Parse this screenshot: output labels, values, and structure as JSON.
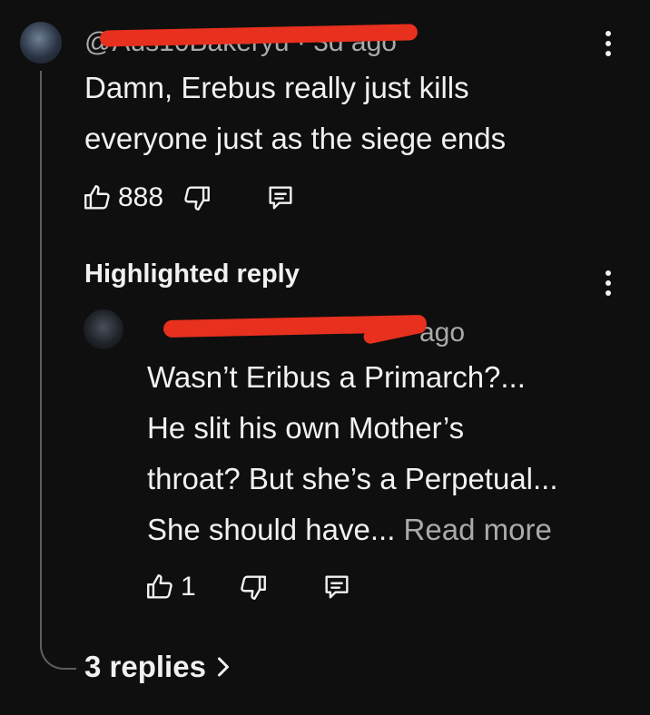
{
  "main_comment": {
    "handle": "@Aus10Bakeryu · 3d ago",
    "text_lines": [
      "Damn, Erebus really just kills",
      "everyone just as the siege ends"
    ],
    "like_count": "888"
  },
  "highlighted_label": "Highlighted reply",
  "reply": {
    "handle_suffix": "ago",
    "text_lines": [
      "Wasn’t Eribus a Primarch?...",
      "He slit his own Mother’s",
      "throat? But she’s a Perpetual...",
      "She should have..."
    ],
    "read_more": "Read more",
    "like_count": "1"
  },
  "replies_link": "3 replies",
  "icons": {
    "like": "thumbs-up-icon",
    "dislike": "thumbs-down-icon",
    "reply": "comment-icon",
    "more": "more-vert-icon",
    "chevron": "chevron-right-icon"
  },
  "colors": {
    "background": "#0f0f0f",
    "text": "#f1f1f1",
    "secondary_text": "#aaaaaa",
    "redaction": "#e8301e"
  }
}
